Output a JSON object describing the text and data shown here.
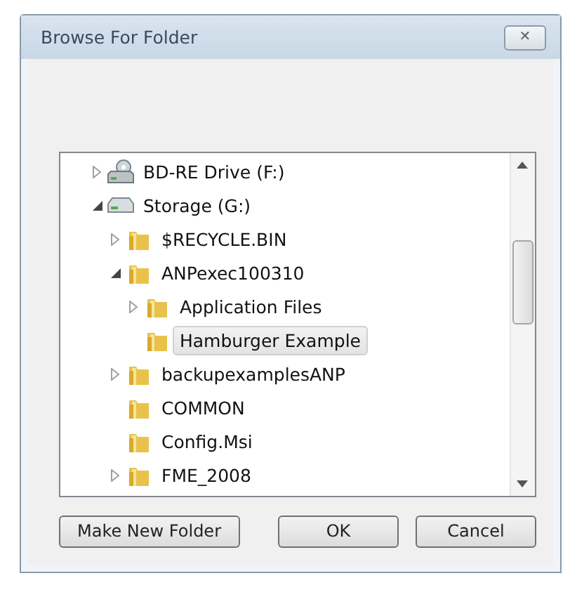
{
  "window": {
    "title": "Browse For Folder",
    "close": "✕"
  },
  "tree": [
    {
      "label": "BD-RE Drive (F:)",
      "kind": "optical-drive",
      "expanded": false,
      "selected": false
    },
    {
      "label": "Storage (G:)",
      "kind": "drive",
      "expanded": true,
      "selected": false,
      "children": [
        {
          "label": "$RECYCLE.BIN",
          "kind": "folder",
          "expanded": false,
          "selected": false
        },
        {
          "label": "ANPexec100310",
          "kind": "folder",
          "expanded": true,
          "selected": false,
          "children": [
            {
              "label": "Application Files",
              "kind": "folder",
              "expanded": false,
              "selected": false
            },
            {
              "label": "Hamburger Example",
              "kind": "folder",
              "selected": true
            }
          ]
        },
        {
          "label": "backupexamplesANP",
          "kind": "folder",
          "expanded": false,
          "selected": false
        },
        {
          "label": "COMMON",
          "kind": "folder",
          "selected": false
        },
        {
          "label": "Config.Msi",
          "kind": "folder",
          "selected": false
        },
        {
          "label": "FME_2008",
          "kind": "folder",
          "expanded": false,
          "selected": false
        }
      ]
    }
  ],
  "buttons": [
    {
      "label": "Make New Folder",
      "kind": "left"
    },
    {
      "label": "OK",
      "kind": "right"
    },
    {
      "label": "Cancel",
      "kind": "right"
    }
  ]
}
